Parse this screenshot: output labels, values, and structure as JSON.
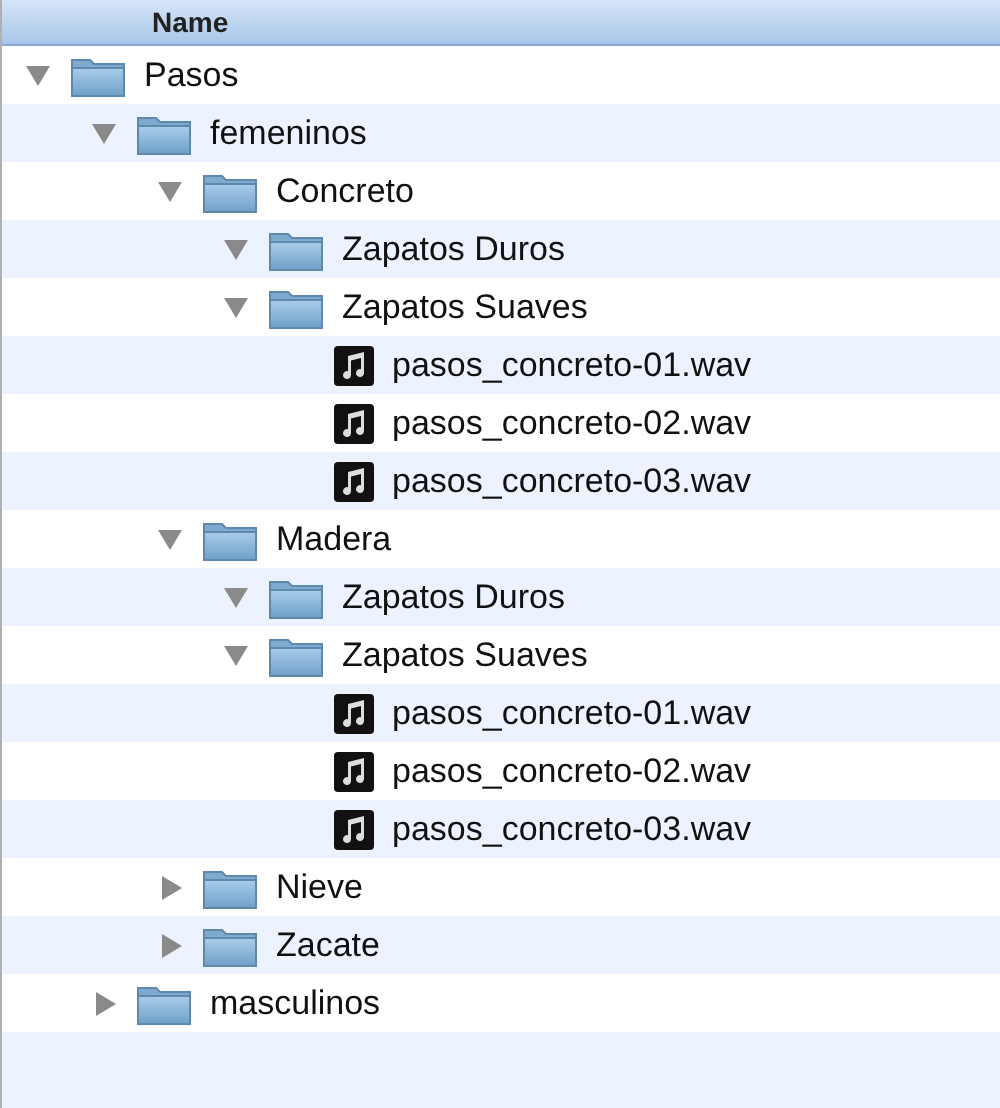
{
  "header": {
    "columns": [
      "Name"
    ]
  },
  "tree": [
    {
      "kind": "folder",
      "name": "Pasos",
      "expanded": true,
      "children": [
        {
          "kind": "folder",
          "name": "femeninos",
          "expanded": true,
          "children": [
            {
              "kind": "folder",
              "name": "Concreto",
              "expanded": true,
              "children": [
                {
                  "kind": "folder",
                  "name": "Zapatos Duros",
                  "expanded": true
                },
                {
                  "kind": "folder",
                  "name": "Zapatos Suaves",
                  "expanded": true,
                  "children": [
                    {
                      "kind": "file",
                      "name": "pasos_concreto-01.wav"
                    },
                    {
                      "kind": "file",
                      "name": "pasos_concreto-02.wav"
                    },
                    {
                      "kind": "file",
                      "name": "pasos_concreto-03.wav"
                    }
                  ]
                }
              ]
            },
            {
              "kind": "folder",
              "name": "Madera",
              "expanded": true,
              "children": [
                {
                  "kind": "folder",
                  "name": "Zapatos Duros",
                  "expanded": true
                },
                {
                  "kind": "folder",
                  "name": "Zapatos Suaves",
                  "expanded": true,
                  "children": [
                    {
                      "kind": "file",
                      "name": "pasos_concreto-01.wav"
                    },
                    {
                      "kind": "file",
                      "name": "pasos_concreto-02.wav"
                    },
                    {
                      "kind": "file",
                      "name": "pasos_concreto-03.wav"
                    }
                  ]
                }
              ]
            },
            {
              "kind": "folder",
              "name": "Nieve",
              "expanded": false
            },
            {
              "kind": "folder",
              "name": "Zacate",
              "expanded": false
            }
          ]
        },
        {
          "kind": "folder",
          "name": "masculinos",
          "expanded": false
        }
      ]
    }
  ]
}
